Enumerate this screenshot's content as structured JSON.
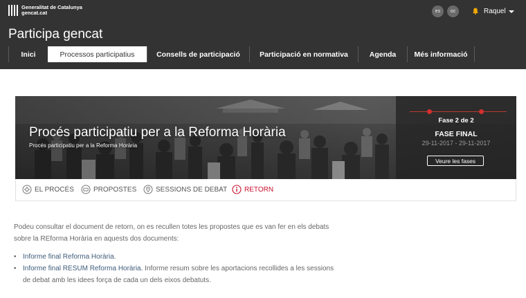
{
  "header": {
    "logo_line1": "Generalitat de Catalunya",
    "logo_line2": "gencat.cat",
    "languages": [
      "es",
      "oc"
    ],
    "user_name": "Raquel",
    "site_title": "Participa gencat"
  },
  "tabs": [
    {
      "label": "Inici"
    },
    {
      "label": "Processos participatius"
    },
    {
      "label": "Consells de participació"
    },
    {
      "label": "Participació en normativa"
    },
    {
      "label": "Agenda"
    },
    {
      "label": "Més informació"
    }
  ],
  "hero": {
    "title": "Procés participatiu per a la Reforma Horària",
    "subtitle": "Procés participatiu per a la Reforma Horària",
    "phase_count": "Fase 2 de 2",
    "phase_name": "FASE FINAL",
    "phase_dates": "29-11-2017 - 29-11-2017",
    "phases_button": "Veure les fases"
  },
  "subnav": [
    {
      "label": "EL PROCÉS",
      "icon": "gear-icon"
    },
    {
      "label": "PROPOSTES",
      "icon": "speech-bubble-icon"
    },
    {
      "label": "SESSIONS DE DEBAT",
      "icon": "map-pin-icon"
    },
    {
      "label": "RETORN",
      "icon": "info-icon"
    }
  ],
  "content": {
    "intro_line1": "Podeu consultar el document de retorn, on es recullen totes les propostes que es van fer en els debats",
    "intro_line2": "sobre la REforma Horària en aquests dos documents:",
    "doc1_link": "Informe final Reforma Horària.",
    "doc2_link": "Informe final RESUM Reforma Horària.",
    "doc2_text1": " Informe resum sobre les aportacions recollides a les sessions",
    "doc2_text2": "de debat amb les idees força de cada un dels eixos debatuts."
  },
  "colors": {
    "header_bg": "#333333",
    "accent_red": "#c8102e",
    "link_blue": "#3d5b7a"
  }
}
